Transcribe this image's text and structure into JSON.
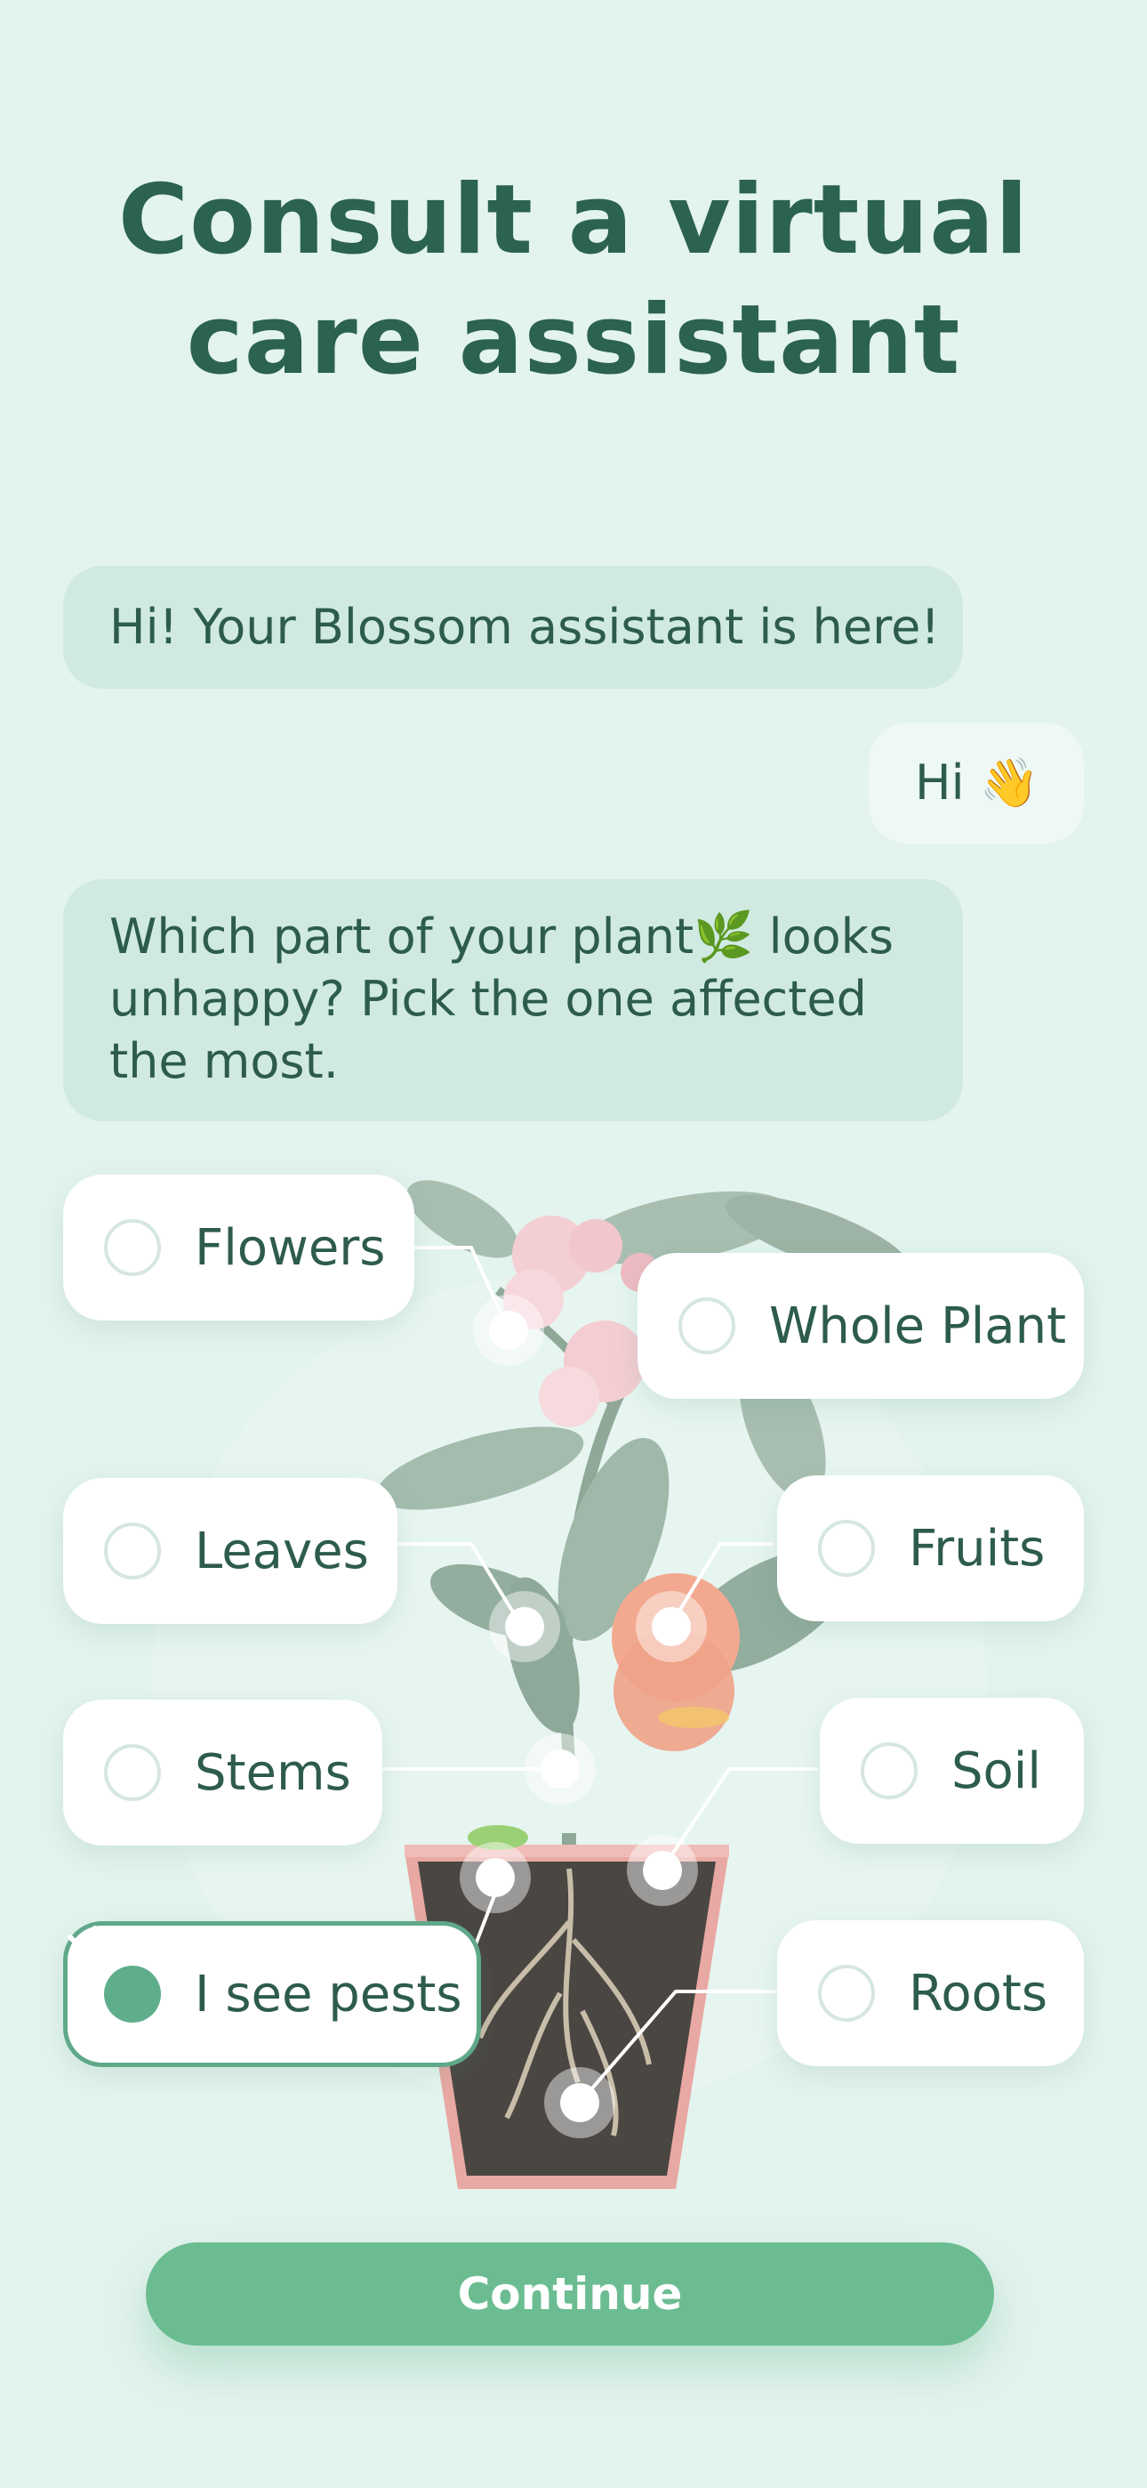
{
  "title_lines": [
    "Consult a virtual",
    "care assistant"
  ],
  "chat": {
    "assistant_greeting": "Hi! Your Blossom assistant is here!",
    "user_reply": "Hi 👋",
    "assistant_question": "Which part of your plant🌿 looks unhappy? Pick the one affected the most."
  },
  "options": {
    "flowers": "Flowers",
    "whole_plant": "Whole Plant",
    "leaves": "Leaves",
    "fruits": "Fruits",
    "stems": "Stems",
    "soil": "Soil",
    "pests": "I see pests",
    "roots": "Roots"
  },
  "selected_option": "I see pests",
  "continue_label": "Continue",
  "colors": {
    "background": "#e3f3ee",
    "title": "#2b6250",
    "accent": "#6bbd91",
    "assistant_bubble": "#d0eae2",
    "user_bubble": "#eef9f5"
  },
  "icons": [
    "radio-empty-icon",
    "radio-checked-icon",
    "plant-illustration"
  ]
}
